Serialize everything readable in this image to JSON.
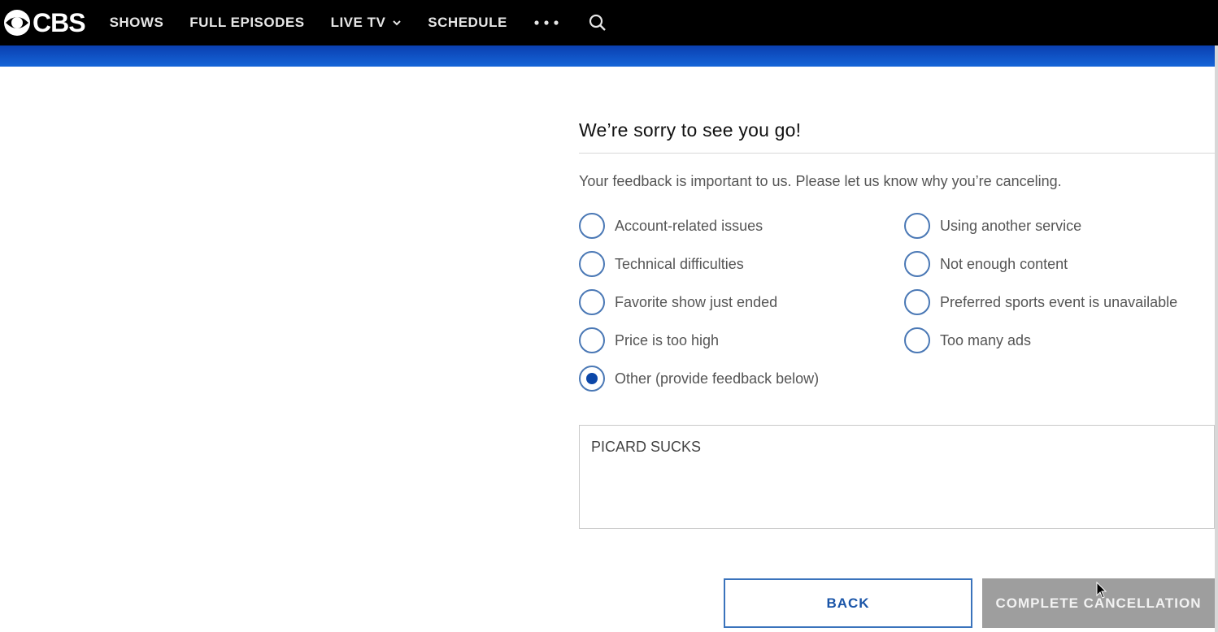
{
  "nav": {
    "logo_text": "CBS",
    "items": [
      "SHOWS",
      "FULL EPISODES",
      "LIVE TV",
      "SCHEDULE"
    ],
    "more_icon": "more-dots-icon",
    "search_icon": "search-icon"
  },
  "form": {
    "heading": "We’re sorry to see you go!",
    "intro": "Your feedback is important to us. Please let us know why you’re canceling.",
    "options_left": [
      "Account-related issues",
      "Technical difficulties",
      "Favorite show just ended",
      "Price is too high",
      "Other (provide feedback below)"
    ],
    "options_right": [
      "Using another service",
      "Not enough content",
      "Preferred sports event is unavailable",
      "Too many ads"
    ],
    "selected": "Other (provide feedback below)",
    "feedback_value": "PICARD SUCKS"
  },
  "buttons": {
    "back": "BACK",
    "complete": "COMPLETE CANCELLATION"
  },
  "colors": {
    "nav_bg": "#000000",
    "band": "#1565d8",
    "radio_border": "#4a78b5",
    "radio_selected": "#0c47a8",
    "button_disabled": "#9e9e9e"
  }
}
